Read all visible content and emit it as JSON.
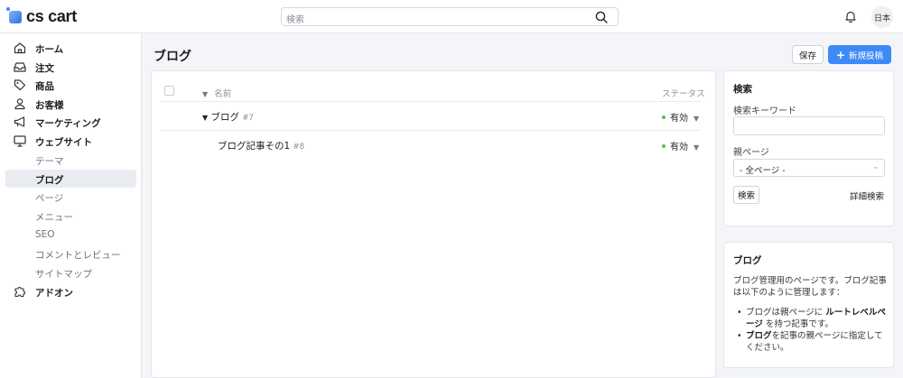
{
  "app": {
    "logo_text": "cs cart",
    "search_placeholder": "検索",
    "lang_label": "日本"
  },
  "sidebar": {
    "items": [
      {
        "label": "ホーム",
        "icon": "home-icon"
      },
      {
        "label": "注文",
        "icon": "inbox-icon"
      },
      {
        "label": "商品",
        "icon": "tag-icon"
      },
      {
        "label": "お客様",
        "icon": "user-icon"
      },
      {
        "label": "マーケティング",
        "icon": "megaphone-icon"
      },
      {
        "label": "ウェブサイト",
        "icon": "monitor-icon"
      }
    ],
    "subitems": [
      {
        "label": "テーマ"
      },
      {
        "label": "ブログ",
        "active": true
      },
      {
        "label": "ページ"
      },
      {
        "label": "メニュー"
      },
      {
        "label": "SEO"
      },
      {
        "label": "コメントとレビュー"
      },
      {
        "label": "サイトマップ"
      }
    ],
    "addons": {
      "label": "アドオン",
      "icon": "puzzle-icon"
    }
  },
  "page": {
    "title": "ブログ",
    "save_label": "保存",
    "new_post_label": "新規投稿"
  },
  "table": {
    "col_name": "名前",
    "col_status": "ステータス",
    "rows": [
      {
        "name": "ブログ",
        "id": "#7",
        "status": "有効"
      },
      {
        "name": "ブログ記事その1",
        "id": "#8",
        "status": "有効"
      }
    ]
  },
  "search_panel": {
    "title": "検索",
    "keyword_label": "検索キーワード",
    "keyword_value": "",
    "parent_label": "親ページ",
    "parent_value": "- 全ページ -",
    "search_button": "検索",
    "advanced_link": "詳細検索"
  },
  "info_panel": {
    "title": "ブログ",
    "intro": "ブログ管理用のページです。ブログ記事は以下のように管理します：",
    "bullet1_pre": "ブログは親ページに",
    "bullet1_bold": "ルートレベルページ",
    "bullet1_post": "を持つ記事です。",
    "bullet2_bold": "ブログ",
    "bullet2_post": "を記事の親ページに指定してください。"
  },
  "colors": {
    "accent": "#3d8af7",
    "active_status": "#5cb85c",
    "background": "#f3f5f8"
  }
}
